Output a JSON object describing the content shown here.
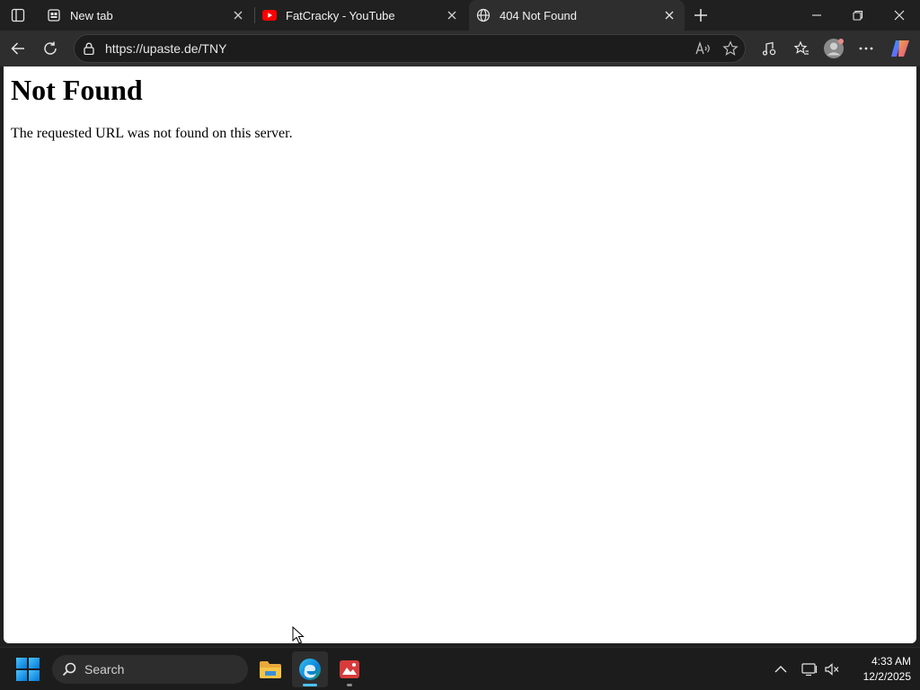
{
  "browser": {
    "tabs": [
      {
        "title": "New tab",
        "icon": "new-tab-page-icon",
        "active": false
      },
      {
        "title": "FatCracky - YouTube",
        "icon": "youtube-icon",
        "active": false
      },
      {
        "title": "404 Not Found",
        "icon": "globe-icon",
        "active": true
      }
    ],
    "address": {
      "url": "https://upaste.de/TNY"
    }
  },
  "page": {
    "heading": "Not Found",
    "message": "The requested URL was not found on this server."
  },
  "taskbar": {
    "search_label": "Search",
    "clock": {
      "time": "4:33 AM",
      "date": "12/2/2025"
    }
  },
  "colors": {
    "youtube_red": "#ff0000",
    "edge_blue": "#0078d4",
    "accent_indicator": "#4cc2ff",
    "app_red": "#d83b3b"
  }
}
